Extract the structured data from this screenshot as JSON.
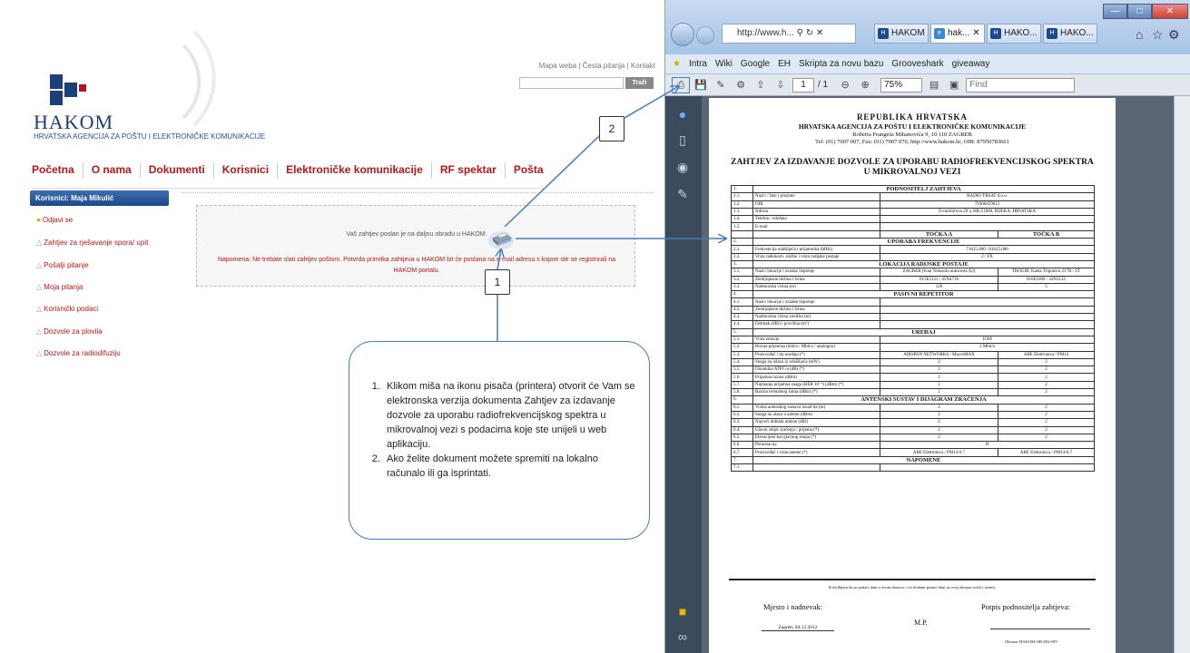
{
  "site": {
    "top_links": [
      "Mapa weba",
      "Česta pitanja",
      "Kontakt"
    ],
    "top_sep": " | ",
    "search_button": "Traži",
    "brand_name": "HAKOM",
    "brand_subtitle": "HRVATSKA AGENCIJA ZA POŠTU I ELEKTRONIČKE KOMUNIKACIJE",
    "nav": [
      "Početna",
      "O nama",
      "Dokumenti",
      "Korisnici",
      "Elektroničke komunikacije",
      "RF spektar",
      "Pošta"
    ],
    "user_bar": "Korisnici: Maja Mikulić",
    "menu": [
      "Odjavi se",
      "Zahtjev za rješavanje spora/ upit",
      "Pošalji pitanje",
      "Moja pitanja",
      "Korisnički podaci",
      "Dozvole za plovila",
      "Dozvole za radiodifuziju"
    ],
    "notice_line1": "Vaš zahtjev poslan je na daljnu obradu u HAKOM.",
    "notice_line2": "Napomena: Ne trebate slati zahtjev poštom. Potvrda primitka zahtjeva u HAKOM bit će poslana na e-mail adresu s kojom ste se registrirali na HAKOM portalu."
  },
  "callouts": {
    "badge1": "1",
    "badge2": "2",
    "steps": [
      "Klikom miša na ikonu pisača (printera) otvorit će Vam se elektronska verzija dokumenta Zahtjev za izdavanje dozvole za uporabu radiofrekvencijskog spektra u mikrovalnoj vezi s podacima koje ste unijeli u web aplikaciju.",
      "Ako želite dokument možete spremiti na lokalno računalo ili ga isprintati."
    ]
  },
  "browser": {
    "address": "http://www.h...",
    "tabs": [
      "HAKOM",
      "hak...",
      "HAKO...",
      "HAKO..."
    ],
    "favorites": [
      "Intra",
      "Wiki",
      "Google",
      "EH",
      "Skripta za novu bazu",
      "Grooveshark",
      "giveaway"
    ],
    "page_current": "1",
    "page_total": "/ 1",
    "zoom": "75%",
    "find_placeholder": "Find"
  },
  "pdf": {
    "h1": "REPUBLIKA HRVATSKA",
    "h2": "HRVATSKA AGENCIJA ZA POŠTU I ELEKTRONIČKE KOMUNIKACIJE",
    "h3": "Roberta Frangeša Mihanovića 9, 10 110 ZAGREB",
    "h4": "Tel: (01) 7007 007, Fax: (01) 7007 070, http://www.hakom.hr, OIB: 87950783661",
    "title": "ZAHTJEV ZA IZDAVANJE DOZVOLE ZA UPORABU RADIOFREKVENCIJSKOG SPEKTRA U MIKROVALNOJ VEZI",
    "rows": [
      {
        "k": "sec",
        "n": "1.",
        "t": "PODNOSITELJ ZAHTJEVA"
      },
      {
        "n": "1.1.",
        "l": "Naziv / Ime i prezime",
        "v": "RADIO TRSAT d.o.o."
      },
      {
        "n": "1.2.",
        "l": "OIB",
        "v": "79306459615"
      },
      {
        "n": "1.3.",
        "l": "Adresa",
        "v": "Zvonimirova 20 a, HR-51000, RIJEKA, HRVATSKA"
      },
      {
        "n": "1.4.",
        "l": "Telefon / telefaks",
        "v": ""
      },
      {
        "n": "1.5.",
        "l": "E-mail",
        "v": ""
      },
      {
        "k": "ab",
        "a": "TOČKA A",
        "b": "TOČKA B"
      },
      {
        "k": "sec",
        "n": "2.",
        "t": "UPORABA FREKVENCIJE"
      },
      {
        "n": "2.1.",
        "l": "Frekvencija odašiljača i prijamnika (MHz)",
        "v": "71625.000 / 81625.000"
      },
      {
        "n": "2.2.",
        "l": "Vrsta radiokom. službe i vrsta radijske postaje",
        "v": "2 / FX"
      },
      {
        "k": "sec",
        "n": "3.",
        "t": "LOKACIJA RADIJSKE POSTAJE"
      },
      {
        "n": "3.1.",
        "l": "Naziv lokacije i oznake lisprenje",
        "a": "ZAGREB (Ivan Teskoniu autocesta A3)",
        "b": "TROGIR, Kaeta Tripunico 217B / ST"
      },
      {
        "n": "3.2.",
        "l": "Zemljopisne dužina i širina",
        "a": "015E5121 / 45N4716",
        "b": "016E1609 / 43N3122"
      },
      {
        "n": "3.3.",
        "l": "Nadmorska visina (m)",
        "a": "126",
        "b": "5"
      },
      {
        "k": "sec",
        "n": "4.",
        "t": "PASIVNI REPETITOR"
      },
      {
        "n": "4.1.",
        "l": "Naziv lokacije i oznake lisprenje",
        "v": ""
      },
      {
        "n": "4.2.",
        "l": "Zemljopisne dužina i širina",
        "v": ""
      },
      {
        "n": "4.3.",
        "l": "Nadmorska visina središta (m)",
        "v": ""
      },
      {
        "n": "4.4.",
        "l": "Dobitak (dBi) i površina (m²)",
        "v": ""
      },
      {
        "k": "sec",
        "n": "5.",
        "t": "UREĐAJ"
      },
      {
        "n": "5.1.",
        "l": "Vrsta emisije",
        "v": "1G00"
      },
      {
        "n": "5.2.",
        "l": "Brzina prijenosa (kbit/s / Mbit/s / analogno)",
        "v": "2 Mbit/s"
      },
      {
        "n": "5.3.",
        "l": "Proizvođač i tip uređaja (*)",
        "a": "AIRSPAN NETWORKS / MacroMAX",
        "b": "ABE Elettronica / PM14"
      },
      {
        "n": "5.4.",
        "l": "Snaga na izlazu iz odašiljača (mW)",
        "a": "2",
        "b": "2"
      },
      {
        "n": "5.5.",
        "l": "Dinamika ATPC-a (dB) (*)",
        "a": "2",
        "b": "2"
      },
      {
        "n": "5.6.",
        "l": "Prijamna razina (dBm)",
        "a": "2",
        "b": "2"
      },
      {
        "n": "5.7.",
        "l": "Najmanja prijamna snaga (BER 10⁻⁶) (dBm) (*)",
        "a": "2",
        "b": "2"
      },
      {
        "n": "5.8.",
        "l": "Razina termalnog šuma (dBm) (*)",
        "a": "2",
        "b": "2"
      },
      {
        "k": "sec",
        "n": "6.",
        "t": "ANTENSKI SUSTAV I DIJAGRAM ZRAČENJA"
      },
      {
        "n": "6.1.",
        "l": "Visina antenskog sustava iznad tla (m)",
        "a": "2",
        "b": "2"
      },
      {
        "n": "6.2.",
        "l": "Snaga na ulazu u antenu (dBm)",
        "a": "2",
        "b": "2"
      },
      {
        "n": "6.3.",
        "l": "Najveći dobitak antene (dBi)",
        "a": "2",
        "b": "2"
      },
      {
        "n": "6.4.",
        "l": "Glavni smjer zračenja / prijema (*)",
        "a": "2",
        "b": "2"
      },
      {
        "n": "6.5.",
        "l": "Elevacijski kut glavnog snopa (*)",
        "a": "2",
        "b": "2"
      },
      {
        "n": "6.6.",
        "l": "Polarizacija",
        "v": "H"
      },
      {
        "n": "6.7.",
        "l": "Proizvođač i vrsta antene (*)",
        "a": "ABE Elettronica / PM14-0.7",
        "b": "ABE Elettronica / PM14-0.7"
      },
      {
        "k": "sec",
        "n": "7.",
        "t": "NAPOMENE"
      },
      {
        "n": "7.1.",
        "l": "",
        "v": ""
      }
    ],
    "confirm": "Potvrđujem da su podaci dani u ovom obrascu i svi dodatni podaci dani uz ovaj obrazac točni i istiniti.",
    "place_date_label": "Mjesto i nadnevak:",
    "place_date": "Zagreb, 04.12.2012",
    "signature_label": "Potpis podnositelja zahtjeva:",
    "mp": "M.P.",
    "form_code": "Obrazac HAKOM-OB-Z02-MV"
  },
  "colors": {
    "brand_red": "#b3191c",
    "brand_blue": "#1c3f7a",
    "callout_blue": "#4a7ab8"
  }
}
